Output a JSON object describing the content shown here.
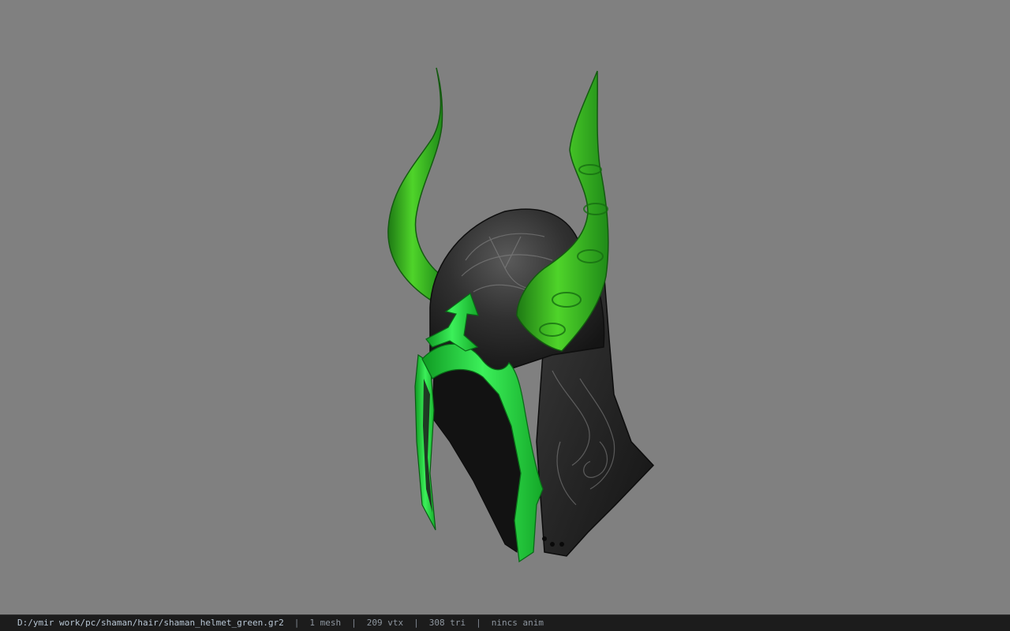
{
  "viewer": {
    "background_color": "#808080",
    "model": {
      "name": "shaman-helmet-green",
      "primary_color": "#2b2b2b",
      "accent_color": "#22d838",
      "horn_color": "#3fbf22"
    }
  },
  "status_bar": {
    "file_path": "D:/ymir work/pc/shaman/hair/shaman_helmet_green.gr2",
    "separator": "|",
    "mesh_count": "1 mesh",
    "vertex_count": "209 vtx",
    "triangle_count": "308 tri",
    "anim_status": "nincs anim"
  }
}
